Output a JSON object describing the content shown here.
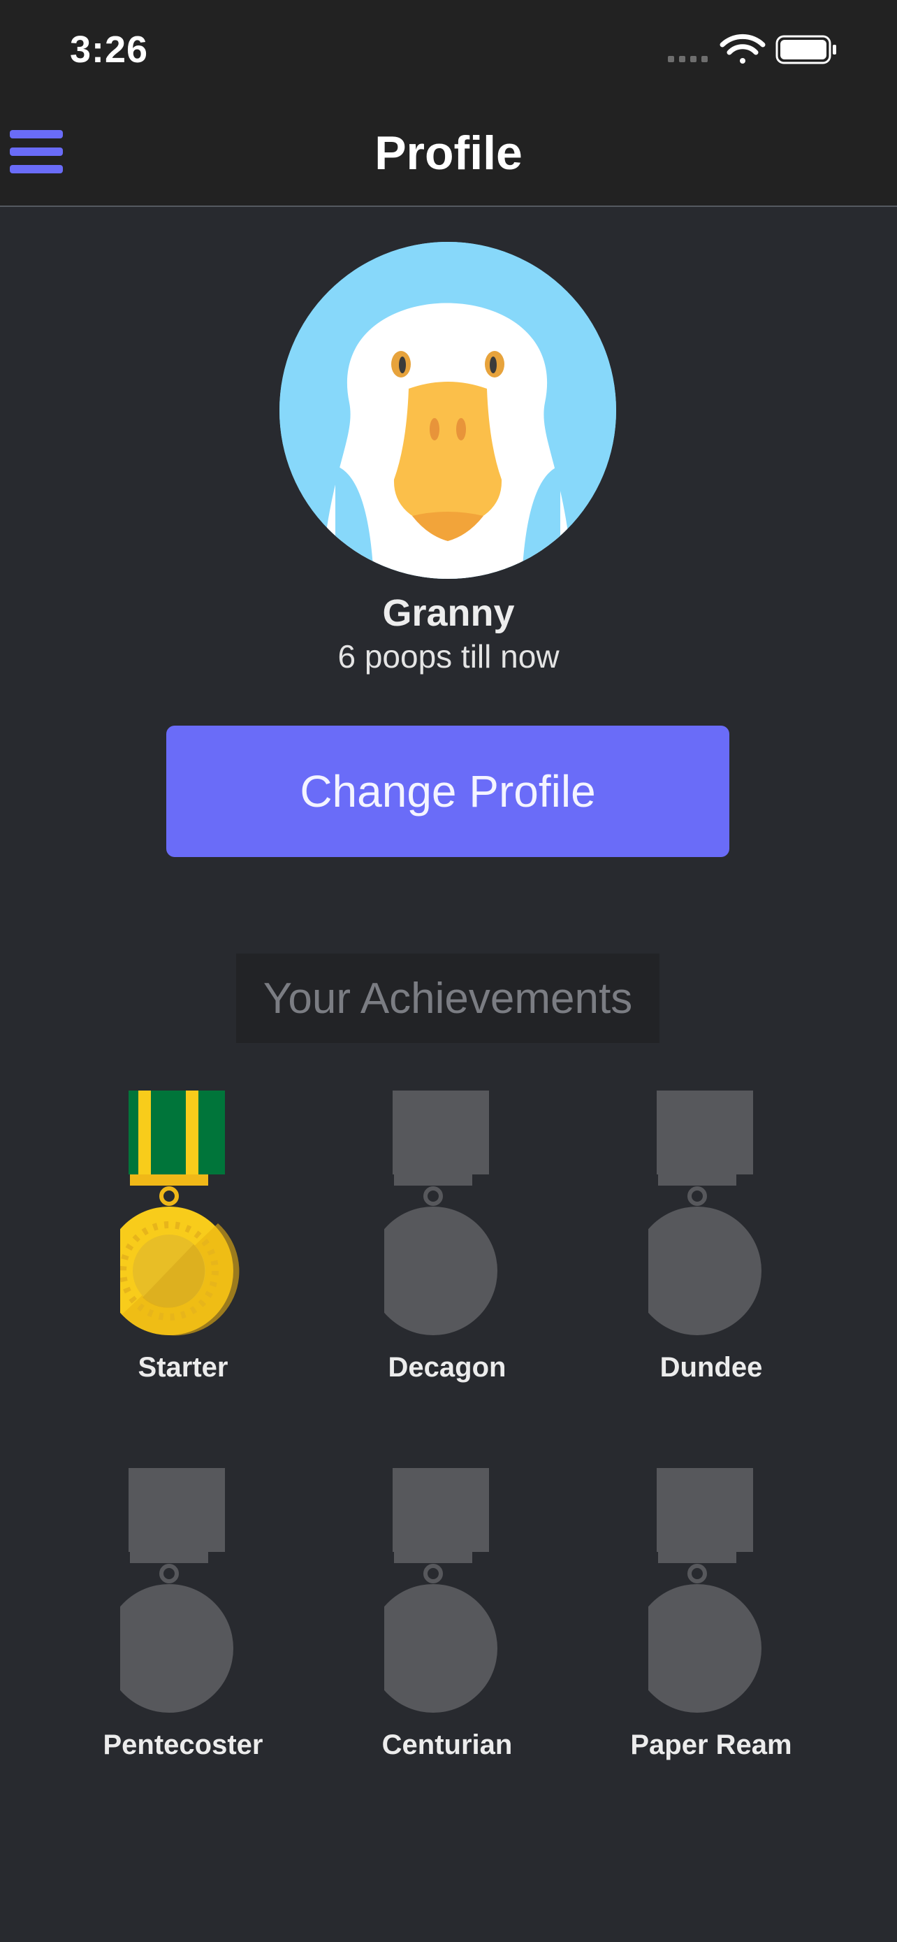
{
  "status_bar": {
    "time": "3:26"
  },
  "nav": {
    "title": "Profile"
  },
  "profile": {
    "name": "Granny",
    "stats": "6 poops till now",
    "change_button_label": "Change Profile"
  },
  "achievements": {
    "header": "Your Achievements",
    "items": [
      {
        "label": "Starter",
        "unlocked": true
      },
      {
        "label": "Decagon",
        "unlocked": false
      },
      {
        "label": "Dundee",
        "unlocked": false
      },
      {
        "label": "Pentecoster",
        "unlocked": false
      },
      {
        "label": "Centurian",
        "unlocked": false
      },
      {
        "label": "Paper Ream",
        "unlocked": false
      }
    ]
  },
  "colors": {
    "background": "#282a2f",
    "bar": "#222222",
    "accent": "#6a6cf8",
    "locked_medal": "#57585c",
    "gold": "#f8cc1b",
    "ribbon_green": "#00753a"
  }
}
